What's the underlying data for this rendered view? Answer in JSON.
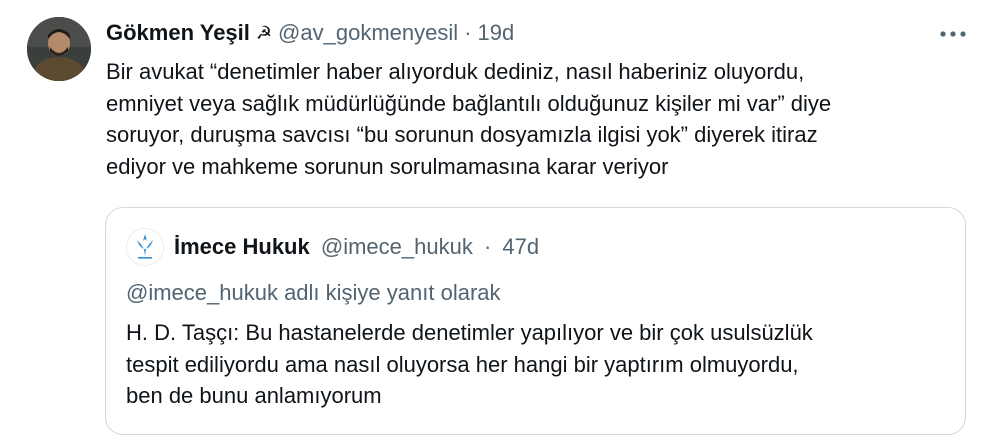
{
  "tweet": {
    "display_name": "Gökmen Yeşil",
    "name_emoji": "☭",
    "handle": "@av_gokmenyesil",
    "separator": "·",
    "time": "19d",
    "text": "Bir avukat “denetimler haber alıyorduk dediniz, nasıl haberiniz oluyordu,\nemniyet veya sağlık müdürlüğünde bağlantılı olduğunuz kişiler mi var” diye\nsoruyor, duruşma savcısı “bu sorunun dosyamızla ilgisi yok” diyerek itiraz\nediyor ve mahkeme sorunun sorulmamasına karar veriyor",
    "more_icon": "more-horizontal-icon"
  },
  "quoted_tweet": {
    "display_name": "İmece Hukuk",
    "handle": "@imece_hukuk",
    "separator": "·",
    "time": "47d",
    "replying_to": "@imece_hukuk adlı kişiye yanıt olarak",
    "text": "H. D. Taşçı: Bu hastanelerde denetimler yapılıyor ve bir çok usulsüzlük\ntespit ediliyordu ama nasıl oluyorsa her hangi bir yaptırım olmuyordu,\nben de bunu anlamıyorum"
  },
  "colors": {
    "text_primary": "#0f1419",
    "text_secondary": "#536471",
    "border": "#cfd9de",
    "logo_blue": "#2f8fd1"
  }
}
